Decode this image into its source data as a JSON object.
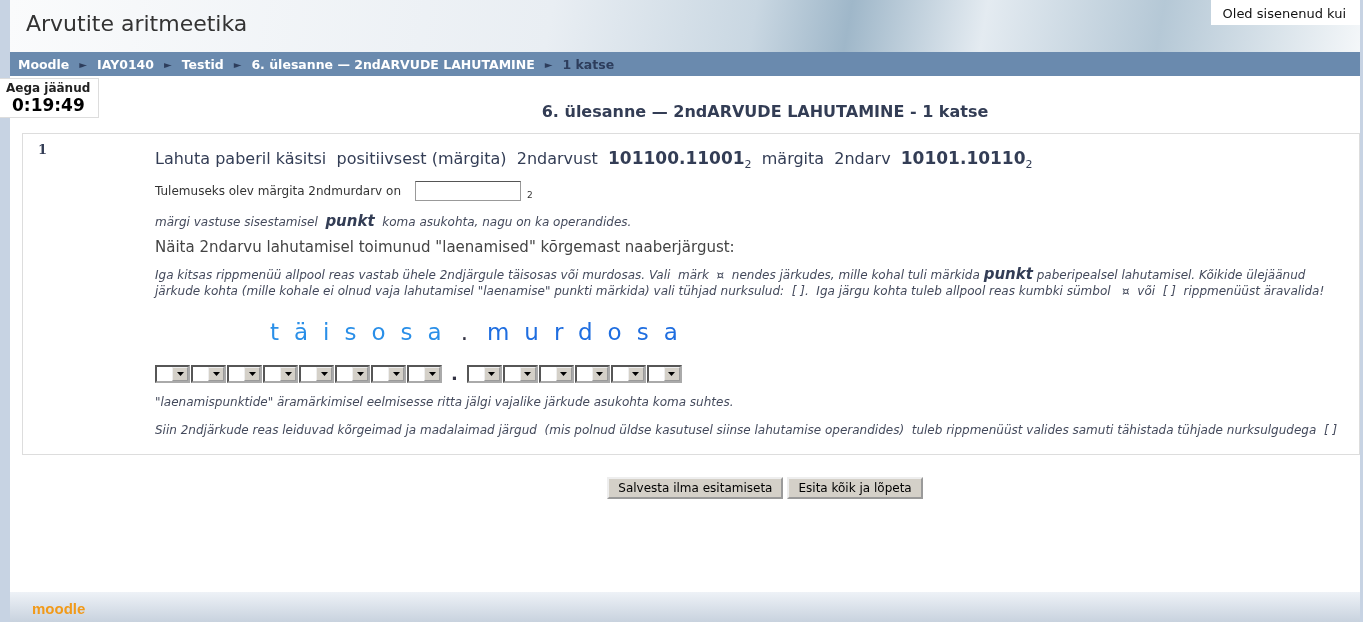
{
  "header": {
    "site_title": "Arvutite aritmeetika",
    "login_info": "Oled sisenenud kui"
  },
  "breadcrumb": [
    {
      "label": "Moodle",
      "current": false
    },
    {
      "label": "IAY0140",
      "current": false
    },
    {
      "label": "Testid",
      "current": false
    },
    {
      "label": "6. ülesanne — 2ndARVUDE LAHUTAMINE",
      "current": false
    },
    {
      "label": "1 katse",
      "current": true
    }
  ],
  "breadcrumb_separator": "►",
  "timer": {
    "label": "Aega jäänud",
    "time": "0:19:49"
  },
  "page_title": "6. ülesanne — 2ndARVUDE LAHUTAMINE - 1 katse",
  "question": {
    "number": "1",
    "statement": "Lahuta paberil käsitsi  positiivsest (märgita)  2ndarvust  **101100.11001**$_{2}$  märgita  2ndarv  **10101.10110**$_{2}$",
    "answer_label": "Tulemuseks olev märgita 2ndmurdarv on",
    "answer_base": "2",
    "answer_note": "märgi vastuse sisestamisel  **punkt**  koma asukohta, nagu on ka operandides.",
    "borrow_heading": "Näita 2ndarvu lahutamisel toimunud \"laenamised\" kõrgemast naaberjärgust:",
    "borrow_instructions": "Iga kitsas rippmenüü allpool reas vastab ühele 2ndjärgule täisosas või murdosas. Vali  märk  ¤  nendes järkudes, mille kohal tuli märkida **punkt** paberipealsel lahutamisel. Kõikide ülejäänud järkude kohta (mille kohale ei olnud vaja lahutamisel \"laenamise\" punkti märkida) vali tühjad nurksulud:  [ ].  Iga järgu kohta tuleb allpool reas kumbki sümbol   ¤  või  [ ]  rippmenüüst äravalida!",
    "integer_caption": "täisosa",
    "point_caption": ".",
    "fraction_caption": "murdosa",
    "integer_digits": [
      {
        "kind": "dropdown"
      },
      {
        "kind": "dropdown"
      },
      {
        "kind": "dropdown"
      },
      {
        "kind": "dropdown"
      },
      {
        "kind": "dropdown"
      },
      {
        "kind": "dropdown"
      },
      {
        "kind": "dropdown"
      },
      {
        "kind": "dropdown"
      }
    ],
    "digit_point": ".",
    "fraction_digits": [
      {
        "kind": "dropdown"
      },
      {
        "kind": "dropdown"
      },
      {
        "kind": "dropdown"
      },
      {
        "kind": "dropdown"
      },
      {
        "kind": "dropdown"
      },
      {
        "kind": "dropdown"
      }
    ],
    "notes": [
      "\"laenamispunktide\" äramärkimisel eelmisesse ritta jälgi vajalike järkude asukohta koma suhtes.",
      "Siin 2ndjärkude reas leiduvad kõrgeimad ja madalaimad järgud  (mis polnud üldse kasutusel siinse lahutamise operandides)  tuleb rippmenüüst valides samuti tähistada tühjade nurksulgudega  [ ]"
    ]
  },
  "buttons": [
    "Salvesta ilma esitamiseta",
    "Esita kõik ja lõpeta"
  ],
  "footer": {
    "logo": "moodle"
  }
}
